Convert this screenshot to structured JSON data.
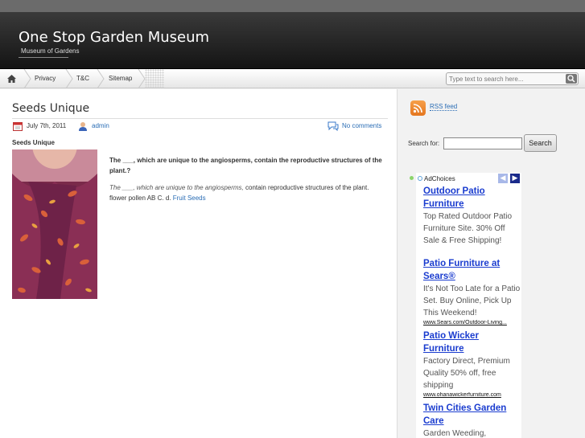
{
  "site": {
    "title": "One Stop Garden Museum",
    "tagline": "Museum of Gardens"
  },
  "nav": {
    "home_icon": "home-icon",
    "items": [
      {
        "label": "Privacy"
      },
      {
        "label": "T&C"
      },
      {
        "label": "Sitemap"
      }
    ],
    "search_placeholder": "Type text to search here...",
    "search_icon": "search-icon"
  },
  "post": {
    "title": "Seeds Unique",
    "date": "July 7th, 2011",
    "author": "admin",
    "comments": "No comments",
    "subheading": "Seeds Unique",
    "question": "The ___, which are unique to the angiosperms, contain the reproductive structures of the plant.?",
    "body_italic": "The ___, which are unique to the angiosperms,",
    "body_rest": " contain reproductive structures of the plant. flower pollen AB C. d. ",
    "body_link": "Fruit Seeds"
  },
  "sidebar": {
    "rss_label": "RSS feed",
    "search_label": "Search for:",
    "search_button": "Search",
    "search_value": ""
  },
  "ads": {
    "adchoices": "AdChoices",
    "items": [
      {
        "title": "Outdoor Patio Furniture",
        "desc": "Top Rated Outdoor Patio Furniture Site. 30% Off Sale & Free Shipping!",
        "url": ""
      },
      {
        "title": "Patio Furniture at Sears®",
        "desc": "It's Not Too Late for a Patio Set. Buy Online, Pick Up This Weekend!",
        "url": "www.Sears.com/Outdoor-Living..."
      },
      {
        "title": "Patio Wicker Furniture",
        "desc": "Factory Direct, Premium Quality 50% off, free shipping",
        "url": "www.ohanawickerfurniture.com"
      },
      {
        "title": "Twin Cities Garden Care",
        "desc": "Garden Weeding,",
        "url": ""
      }
    ]
  },
  "colors": {
    "link": "#2a6db5",
    "ad_title": "#1a3ccf",
    "header_bg": "#1c1c1c",
    "rss": "#e4761f"
  }
}
